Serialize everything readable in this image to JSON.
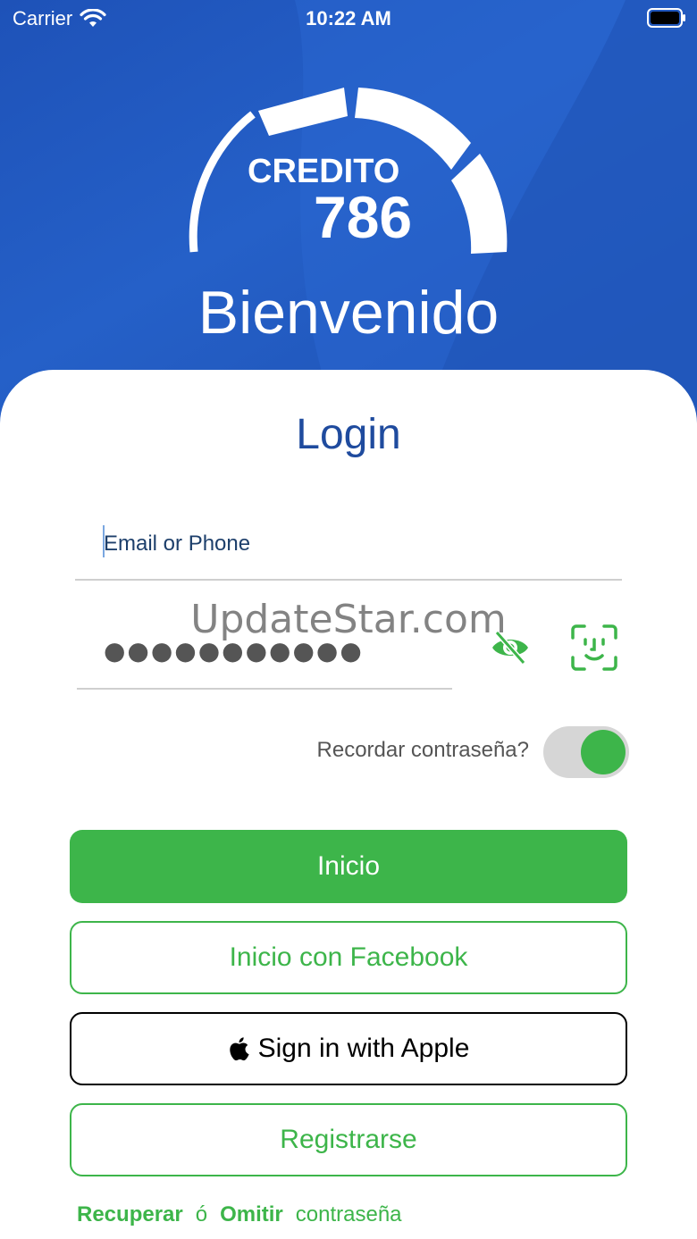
{
  "status_bar": {
    "carrier": "Carrier",
    "time": "10:22 AM"
  },
  "header": {
    "logo_word": "CREDITO",
    "logo_number": "786",
    "welcome": "Bienvenido"
  },
  "login": {
    "title": "Login",
    "email_placeholder": "Email or Phone",
    "password_masked": "●●●●●●●●●●●",
    "remember_label": "Recordar contraseña?",
    "remember_enabled": true
  },
  "buttons": {
    "login": "Inicio",
    "facebook": "Inicio con Facebook",
    "apple": "Sign in with Apple",
    "register": "Registrarse"
  },
  "footer": {
    "recover": "Recuperar",
    "or": "ó",
    "skip": "Omitir",
    "password": "contraseña"
  },
  "watermark": "UpdateStar.com",
  "colors": {
    "header_blue": "#2560c8",
    "title_blue": "#1f4b9e",
    "accent_green": "#3db54a"
  },
  "icons": {
    "wifi": "wifi-icon",
    "battery": "battery-icon",
    "eye": "eye-slash-icon",
    "face": "face-id-icon",
    "apple": "apple-icon"
  }
}
